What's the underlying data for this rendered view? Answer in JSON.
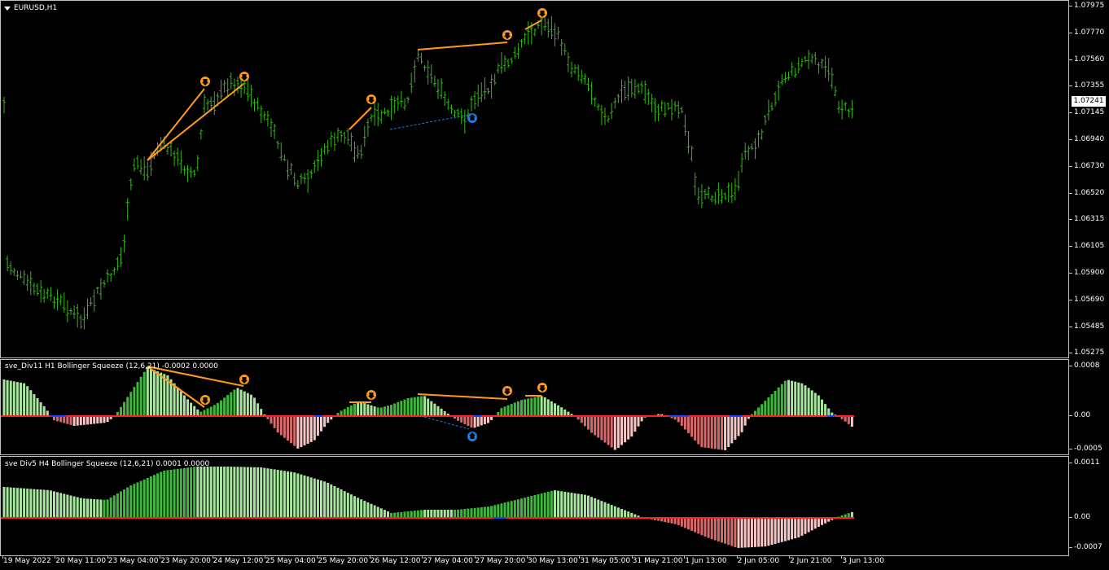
{
  "symbol": {
    "label": "EURUSD,H1"
  },
  "price_scale": [
    "1.07975",
    "1.07770",
    "1.07560",
    "1.07355",
    "1.07145",
    "1.06940",
    "1.06730",
    "1.06520",
    "1.06315",
    "1.06105",
    "1.05900",
    "1.05690",
    "1.05485",
    "1.05275"
  ],
  "current_price": "1.07241",
  "indicator1": {
    "title": "sve_Div11 H1 Bollinger Squeeze (12,6,21) -0.0002 0.0000",
    "scale": [
      "0.0008",
      "0.00",
      "-0.0005"
    ]
  },
  "indicator2": {
    "title": "sve Div5 H4 Bollinger Squeeze (12,6,21) 0.0001 0.0000",
    "scale": [
      "0.0011",
      "0.00",
      "-0.0007"
    ]
  },
  "time_axis": [
    "19 May 2022",
    "20 May 11:00",
    "23 May 04:00",
    "23 May 20:00",
    "24 May 12:00",
    "25 May 04:00",
    "25 May 20:00",
    "26 May 12:00",
    "27 May 04:00",
    "27 May 20:00",
    "30 May 13:00",
    "31 May 05:00",
    "31 May 21:00",
    "1 Jun 13:00",
    "2 Jun 05:00",
    "2 Jun 21:00",
    "3 Jun 13:00"
  ],
  "colors": {
    "background": "#000000",
    "bars": "#33b814",
    "divergence_bear": "#ff9b1c",
    "divergence_bull": "#1e7de0",
    "hist_green_dark": "#3cb83c",
    "hist_green_light": "#a8e6a0",
    "hist_red_dark": "#d96a6a",
    "hist_red_light": "#f6c6c6",
    "zero_red": "#ff2020",
    "zero_blue": "#2040ff"
  }
}
